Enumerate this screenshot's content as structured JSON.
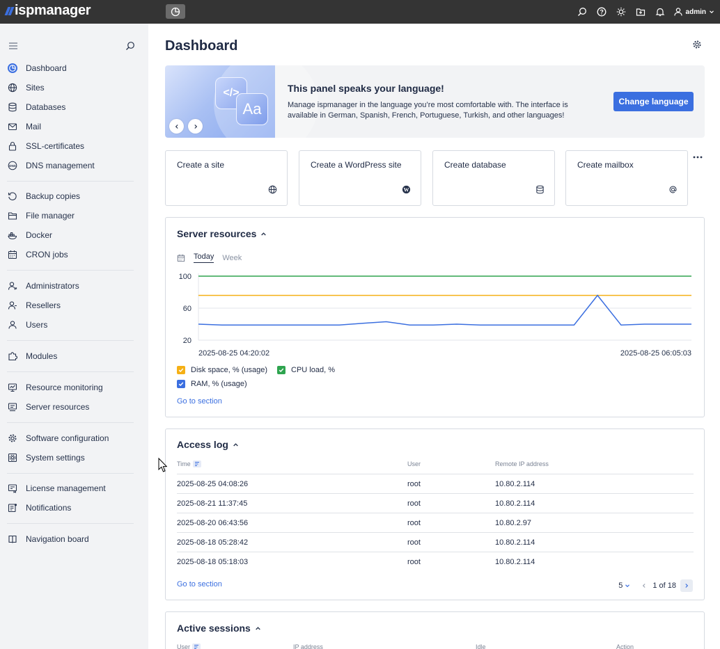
{
  "brand": {
    "name": "ispmanager",
    "accent": "#3b6fe0"
  },
  "topbar": {
    "user": "admin"
  },
  "sidebar": {
    "items": [
      {
        "label": "Dashboard",
        "icon": "dashboard-icon"
      },
      {
        "label": "Sites",
        "icon": "globe-icon"
      },
      {
        "label": "Databases",
        "icon": "database-icon"
      },
      {
        "label": "Mail",
        "icon": "mail-icon"
      },
      {
        "label": "SSL-certificates",
        "icon": "lock-icon"
      },
      {
        "label": "DNS management",
        "icon": "dns-icon"
      },
      {
        "label": "Backup copies",
        "icon": "backup-icon"
      },
      {
        "label": "File manager",
        "icon": "folder-icon"
      },
      {
        "label": "Docker",
        "icon": "docker-icon"
      },
      {
        "label": "CRON jobs",
        "icon": "calendar-icon"
      },
      {
        "label": "Administrators",
        "icon": "admin-user-icon"
      },
      {
        "label": "Resellers",
        "icon": "reseller-icon"
      },
      {
        "label": "Users",
        "icon": "user-icon"
      },
      {
        "label": "Modules",
        "icon": "puzzle-icon"
      },
      {
        "label": "Resource monitoring",
        "icon": "monitoring-icon"
      },
      {
        "label": "Server resources",
        "icon": "server-resources-icon"
      },
      {
        "label": "Software configuration",
        "icon": "gear-icon"
      },
      {
        "label": "System settings",
        "icon": "settings-icon"
      },
      {
        "label": "License management",
        "icon": "license-icon"
      },
      {
        "label": "Notifications",
        "icon": "notifications-icon"
      },
      {
        "label": "Navigation board",
        "icon": "book-icon"
      }
    ]
  },
  "page": {
    "title": "Dashboard"
  },
  "banner": {
    "title": "This panel speaks your language!",
    "text": "Manage ispmanager in the language you’re most comfortable with. The interface is available in German, Spanish, French, Portuguese, Turkish, and other languages!",
    "button": "Change language",
    "art_text_1": "</>",
    "art_text_2": "Aa"
  },
  "quick_actions": [
    {
      "label": "Create a site",
      "icon": "globe-icon"
    },
    {
      "label": "Create a WordPress site",
      "icon": "wordpress-icon"
    },
    {
      "label": "Create database",
      "icon": "database-icon"
    },
    {
      "label": "Create mailbox",
      "icon": "at-icon"
    }
  ],
  "server_resources": {
    "title": "Server resources",
    "tabs": [
      "Today",
      "Week"
    ],
    "active_tab": "Today",
    "link": "Go to section",
    "legend": [
      {
        "label": "Disk space, % (usage)",
        "color": "#f5b015"
      },
      {
        "label": "CPU load, %",
        "color": "#2ea44f"
      },
      {
        "label": "RAM, % (usage)",
        "color": "#3b6fe0"
      }
    ]
  },
  "chart_data": {
    "type": "line",
    "ylim": [
      20,
      100
    ],
    "y_ticks": [
      "100",
      "60",
      "20"
    ],
    "x_start_label": "2025-08-25 04:20:02",
    "x_end_label": "2025-08-25 06:05:03",
    "series": [
      {
        "name": "Disk space, % (usage)",
        "color": "#f5b015",
        "values": [
          76,
          76,
          76,
          76,
          76,
          76,
          76,
          76,
          76,
          76,
          76,
          76,
          76,
          76,
          76,
          76,
          76,
          76,
          76,
          76,
          76,
          76
        ]
      },
      {
        "name": "CPU load, %",
        "color": "#2ea44f",
        "values": [
          100,
          100,
          100,
          100,
          100,
          100,
          100,
          100,
          100,
          100,
          100,
          100,
          100,
          100,
          100,
          100,
          100,
          100,
          100,
          100,
          100,
          100
        ]
      },
      {
        "name": "RAM, % (usage)",
        "color": "#3b6fe0",
        "values": [
          40,
          39,
          39,
          39,
          39,
          39,
          39,
          41,
          43,
          39,
          39,
          40,
          39,
          39,
          39,
          39,
          39,
          76,
          39,
          40,
          40,
          40
        ]
      }
    ]
  },
  "access_log": {
    "title": "Access log",
    "columns": [
      "Time",
      "User",
      "Remote IP address"
    ],
    "rows": [
      [
        "2025-08-25 04:08:26",
        "root",
        "10.80.2.114"
      ],
      [
        "2025-08-21 11:37:45",
        "root",
        "10.80.2.114"
      ],
      [
        "2025-08-20 06:43:56",
        "root",
        "10.80.2.97"
      ],
      [
        "2025-08-18 05:28:42",
        "root",
        "10.80.2.114"
      ],
      [
        "2025-08-18 05:18:03",
        "root",
        "10.80.2.114"
      ]
    ],
    "link": "Go to section",
    "page_size": "5",
    "pagination": "1 of 18"
  },
  "active_sessions": {
    "title": "Active sessions",
    "columns": [
      "User",
      "IP address",
      "Idle",
      "Action"
    ]
  }
}
